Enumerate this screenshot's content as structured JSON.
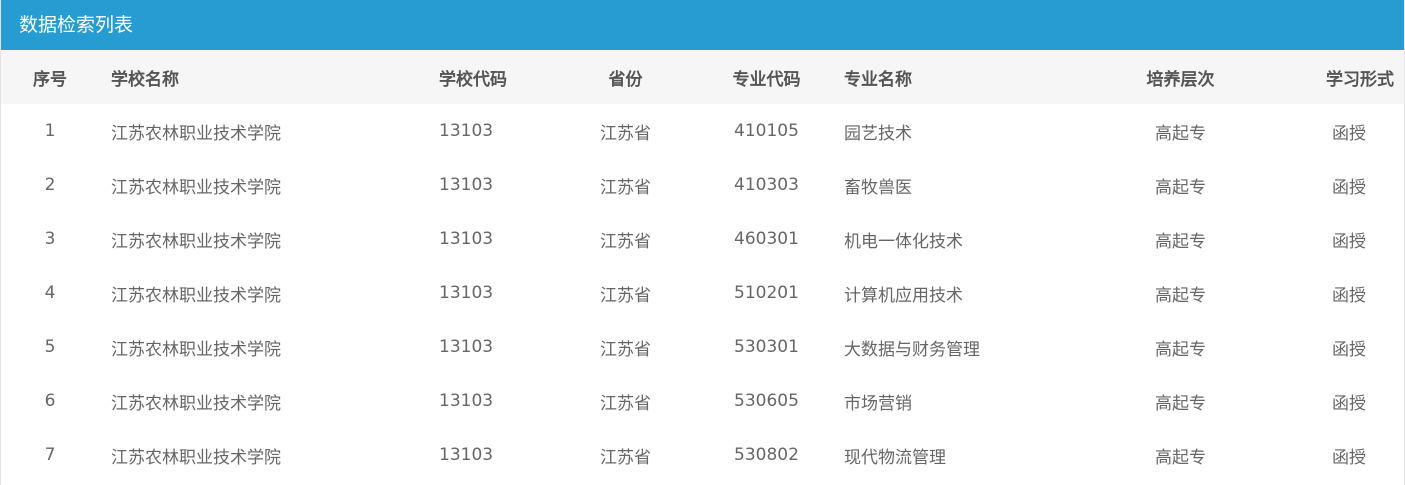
{
  "panel": {
    "title": "数据检索列表"
  },
  "table": {
    "headers": {
      "index": "序号",
      "school_name": "学校名称",
      "school_code": "学校代码",
      "province": "省份",
      "major_code": "专业代码",
      "major_name": "专业名称",
      "level": "培养层次",
      "study_mode": "学习形式"
    },
    "rows": [
      {
        "index": "1",
        "school_name": "江苏农林职业技术学院",
        "school_code": "13103",
        "province": "江苏省",
        "major_code": "410105",
        "major_name": "园艺技术",
        "level": "高起专",
        "study_mode": "函授"
      },
      {
        "index": "2",
        "school_name": "江苏农林职业技术学院",
        "school_code": "13103",
        "province": "江苏省",
        "major_code": "410303",
        "major_name": "畜牧兽医",
        "level": "高起专",
        "study_mode": "函授"
      },
      {
        "index": "3",
        "school_name": "江苏农林职业技术学院",
        "school_code": "13103",
        "province": "江苏省",
        "major_code": "460301",
        "major_name": "机电一体化技术",
        "level": "高起专",
        "study_mode": "函授"
      },
      {
        "index": "4",
        "school_name": "江苏农林职业技术学院",
        "school_code": "13103",
        "province": "江苏省",
        "major_code": "510201",
        "major_name": "计算机应用技术",
        "level": "高起专",
        "study_mode": "函授"
      },
      {
        "index": "5",
        "school_name": "江苏农林职业技术学院",
        "school_code": "13103",
        "province": "江苏省",
        "major_code": "530301",
        "major_name": "大数据与财务管理",
        "level": "高起专",
        "study_mode": "函授"
      },
      {
        "index": "6",
        "school_name": "江苏农林职业技术学院",
        "school_code": "13103",
        "province": "江苏省",
        "major_code": "530605",
        "major_name": "市场营销",
        "level": "高起专",
        "study_mode": "函授"
      },
      {
        "index": "7",
        "school_name": "江苏农林职业技术学院",
        "school_code": "13103",
        "province": "江苏省",
        "major_code": "530802",
        "major_name": "现代物流管理",
        "level": "高起专",
        "study_mode": "函授"
      }
    ]
  },
  "colors": {
    "header_bar": "#279cd3",
    "table_head_bg": "#f6f6f6",
    "head_text": "#555555",
    "cell_text": "#666666"
  }
}
